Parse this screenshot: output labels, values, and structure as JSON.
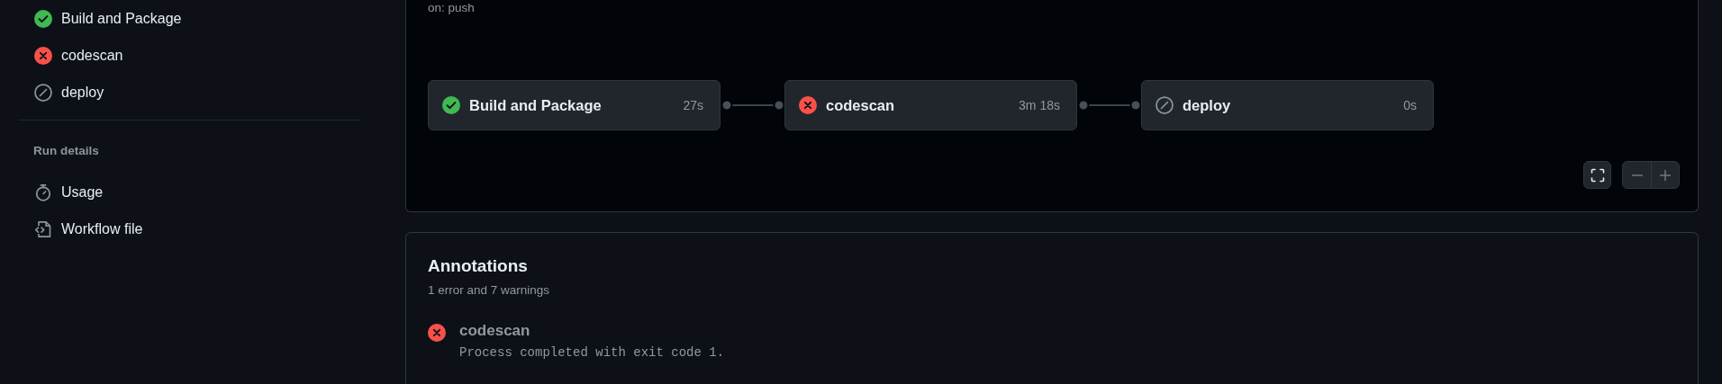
{
  "sidebar": {
    "jobs": [
      {
        "label": "Build and Package",
        "kind": "success"
      },
      {
        "label": "codescan",
        "kind": "failure"
      },
      {
        "label": "deploy",
        "kind": "skipped"
      }
    ],
    "section_title": "Run details",
    "details": [
      {
        "label": "Usage",
        "kind": "usage"
      },
      {
        "label": "Workflow file",
        "kind": "file"
      }
    ]
  },
  "graph": {
    "trigger": "on: push",
    "nodes": [
      {
        "label": "Build and Package",
        "duration": "27s",
        "kind": "success"
      },
      {
        "label": "codescan",
        "duration": "3m 18s",
        "kind": "failure"
      },
      {
        "label": "deploy",
        "duration": "0s",
        "kind": "skipped"
      }
    ]
  },
  "annotations": {
    "title": "Annotations",
    "summary": "1 error and 7 warnings",
    "items": [
      {
        "title": "codescan",
        "message": "Process completed with exit code 1.",
        "kind": "failure"
      }
    ]
  }
}
